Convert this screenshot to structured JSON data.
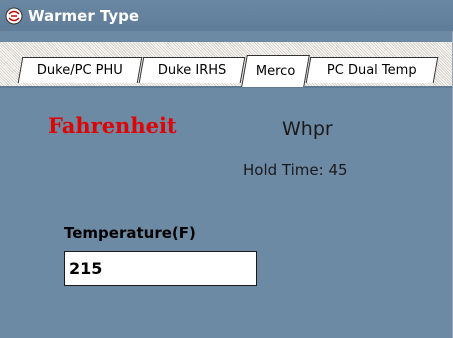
{
  "window": {
    "title": "Warmer Type",
    "icon": "app-icon"
  },
  "tabs": [
    {
      "label": "Duke/PC PHU",
      "active": false
    },
    {
      "label": "Duke IRHS",
      "active": false
    },
    {
      "label": "Merco",
      "active": true
    },
    {
      "label": "PC Dual Temp",
      "active": false
    }
  ],
  "panel": {
    "unit_label": "Fahrenheit",
    "warmer_name": "Whpr",
    "hold_time": "Hold Time: 45",
    "temperature_label": "Temperature(F)",
    "temperature_value": "215"
  },
  "colors": {
    "background": "#6d8aa5",
    "unit_label": "#e00000"
  }
}
